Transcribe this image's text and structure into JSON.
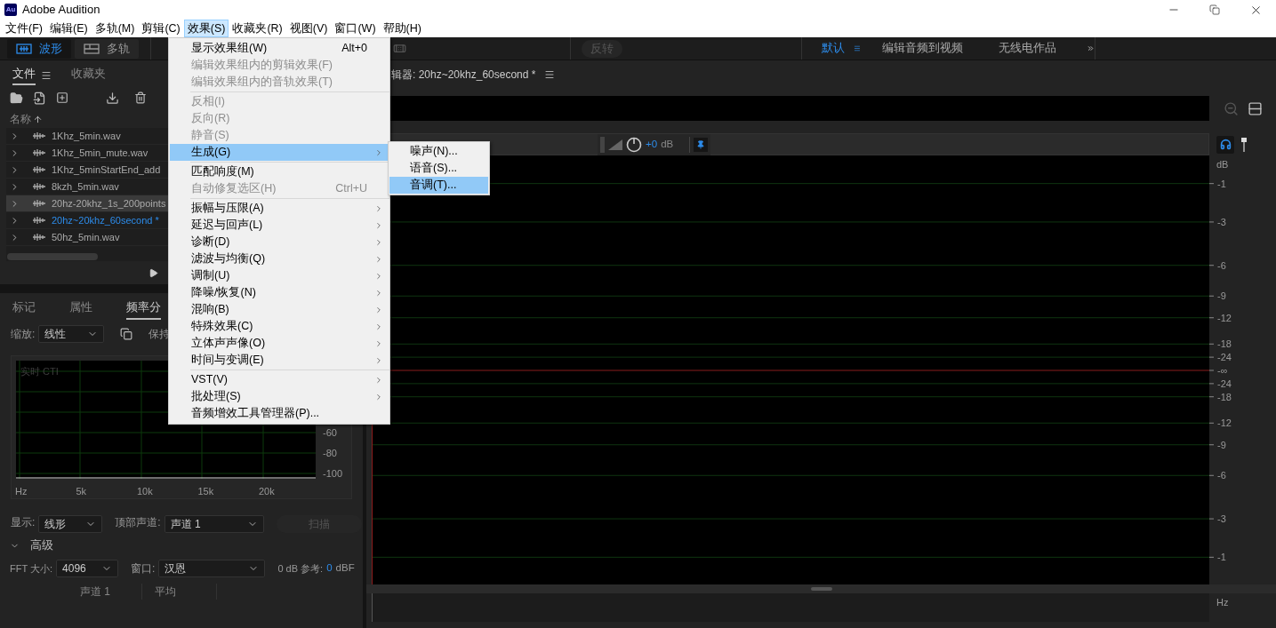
{
  "window": {
    "app_icon": "Au",
    "title": "Adobe Audition"
  },
  "menu_bar": [
    {
      "label": "文件(F)",
      "selected": false
    },
    {
      "label": "编辑(E)",
      "selected": false
    },
    {
      "label": "多轨(M)",
      "selected": false
    },
    {
      "label": "剪辑(C)",
      "selected": false
    },
    {
      "label": "效果(S)",
      "selected": true
    },
    {
      "label": "收藏夹(R)",
      "selected": false
    },
    {
      "label": "视图(V)",
      "selected": false
    },
    {
      "label": "窗口(W)",
      "selected": false
    },
    {
      "label": "帮助(H)",
      "selected": false
    }
  ],
  "toolbar": {
    "views": [
      {
        "label": "波形",
        "kind": "waveform",
        "selected": true
      },
      {
        "label": "多轨",
        "kind": "multitrack",
        "selected": false
      }
    ],
    "invert_button": {
      "label": "反转",
      "disabled": true
    },
    "workspaces": [
      {
        "label": "默认",
        "selected": true
      },
      {
        "label": "编辑音频到视频",
        "selected": false
      },
      {
        "label": "无线电作品",
        "selected": false
      }
    ]
  },
  "files_panel": {
    "tabs": [
      {
        "label": "文件",
        "selected": true
      },
      {
        "label": "收藏夹",
        "selected": false
      }
    ],
    "column_header": "名称",
    "files": [
      {
        "name": "1Khz_5min.wav",
        "selected": false,
        "open": false
      },
      {
        "name": "1Khz_5min_mute.wav",
        "selected": false,
        "open": false
      },
      {
        "name": "1Khz_5minStartEnd_add",
        "selected": false,
        "open": false
      },
      {
        "name": "8kzh_5min.wav",
        "selected": false,
        "open": false
      },
      {
        "name": "20hz-20khz_1s_200points",
        "selected": true,
        "open": false
      },
      {
        "name": "20hz~20khz_60second *",
        "selected": false,
        "open": true
      },
      {
        "name": "50hz_5min.wav",
        "selected": false,
        "open": false
      }
    ]
  },
  "lower_panel": {
    "tabs": [
      {
        "label": "标记",
        "selected": false
      },
      {
        "label": "属性",
        "selected": false
      },
      {
        "label": "频率分",
        "selected": true
      }
    ],
    "scale": {
      "label": "缩放:",
      "value": "线性"
    },
    "hold_label": "保持",
    "chart": {
      "overlay_label": "实时 CTI",
      "y_labels": [
        "-60",
        "-80",
        "-100"
      ],
      "x_labels": [
        "Hz",
        "5k",
        "10k",
        "15k",
        "20k"
      ]
    },
    "display": {
      "label": "显示:",
      "value": "线形"
    },
    "top_channel": {
      "label": "顶部声道:",
      "value": "声道 1"
    },
    "scan_button": {
      "label": "扫描",
      "disabled": true
    },
    "advanced": {
      "label": "高级",
      "expanded": true
    },
    "fft_size": {
      "label": "FFT 大小:",
      "value": "4096"
    },
    "window_fn": {
      "label": "窗口:",
      "value": "汉恩"
    },
    "reference": {
      "label": "0 dB 参考:",
      "value": "0",
      "unit": "dBF"
    },
    "table_columns": [
      "声道 1",
      "平均"
    ]
  },
  "editor": {
    "tab_title": "辑器: 20hz~20khz_60second *",
    "gain": {
      "value": "+0",
      "unit": "dB"
    },
    "db_axis": {
      "unit": "dB",
      "labels": [
        "-1",
        "-3",
        "-6",
        "-9",
        "-12",
        "-18",
        "-24",
        "-∞",
        "-24",
        "-18",
        "-12",
        "-9",
        "-6",
        "-3",
        "-1"
      ]
    },
    "hz_label": "Hz"
  },
  "effects_menu": {
    "items": [
      {
        "kind": "item",
        "label": "显示效果组(W)",
        "shortcut": "Alt+0",
        "disabled": false,
        "submenu": false,
        "selected": false
      },
      {
        "kind": "item",
        "label": "编辑效果组内的剪辑效果(F)",
        "disabled": true,
        "submenu": false,
        "selected": false
      },
      {
        "kind": "item",
        "label": "编辑效果组内的音轨效果(T)",
        "disabled": true,
        "submenu": false,
        "selected": false
      },
      {
        "kind": "separator"
      },
      {
        "kind": "item",
        "label": "反相(I)",
        "disabled": true,
        "submenu": false,
        "selected": false
      },
      {
        "kind": "item",
        "label": "反向(R)",
        "disabled": true,
        "submenu": false,
        "selected": false
      },
      {
        "kind": "item",
        "label": "静音(S)",
        "disabled": true,
        "submenu": false,
        "selected": false
      },
      {
        "kind": "item",
        "label": "生成(G)",
        "disabled": false,
        "submenu": true,
        "selected": true
      },
      {
        "kind": "separator"
      },
      {
        "kind": "item",
        "label": "匹配响度(M)",
        "disabled": false,
        "submenu": false,
        "selected": false
      },
      {
        "kind": "item",
        "label": "自动修复选区(H)",
        "shortcut": "Ctrl+U",
        "disabled": true,
        "submenu": false,
        "selected": false
      },
      {
        "kind": "separator"
      },
      {
        "kind": "item",
        "label": "振幅与压限(A)",
        "disabled": false,
        "submenu": true,
        "selected": false
      },
      {
        "kind": "item",
        "label": "延迟与回声(L)",
        "disabled": false,
        "submenu": true,
        "selected": false
      },
      {
        "kind": "item",
        "label": "诊断(D)",
        "disabled": false,
        "submenu": true,
        "selected": false
      },
      {
        "kind": "item",
        "label": "滤波与均衡(Q)",
        "disabled": false,
        "submenu": true,
        "selected": false
      },
      {
        "kind": "item",
        "label": "调制(U)",
        "disabled": false,
        "submenu": true,
        "selected": false
      },
      {
        "kind": "item",
        "label": "降噪/恢复(N)",
        "disabled": false,
        "submenu": true,
        "selected": false
      },
      {
        "kind": "item",
        "label": "混响(B)",
        "disabled": false,
        "submenu": true,
        "selected": false
      },
      {
        "kind": "item",
        "label": "特殊效果(C)",
        "disabled": false,
        "submenu": true,
        "selected": false
      },
      {
        "kind": "item",
        "label": "立体声声像(O)",
        "disabled": false,
        "submenu": true,
        "selected": false
      },
      {
        "kind": "item",
        "label": "时间与变调(E)",
        "disabled": false,
        "submenu": true,
        "selected": false
      },
      {
        "kind": "separator"
      },
      {
        "kind": "item",
        "label": "VST(V)",
        "disabled": false,
        "submenu": true,
        "selected": false
      },
      {
        "kind": "item",
        "label": "批处理(S)",
        "disabled": false,
        "submenu": true,
        "selected": false
      },
      {
        "kind": "item",
        "label": "音频增效工具管理器(P)...",
        "disabled": false,
        "submenu": false,
        "selected": false
      }
    ]
  },
  "generate_submenu": {
    "items": [
      {
        "label": "噪声(N)...",
        "selected": false
      },
      {
        "label": "语音(S)...",
        "selected": false
      },
      {
        "label": "音调(T)...",
        "selected": true
      }
    ]
  }
}
